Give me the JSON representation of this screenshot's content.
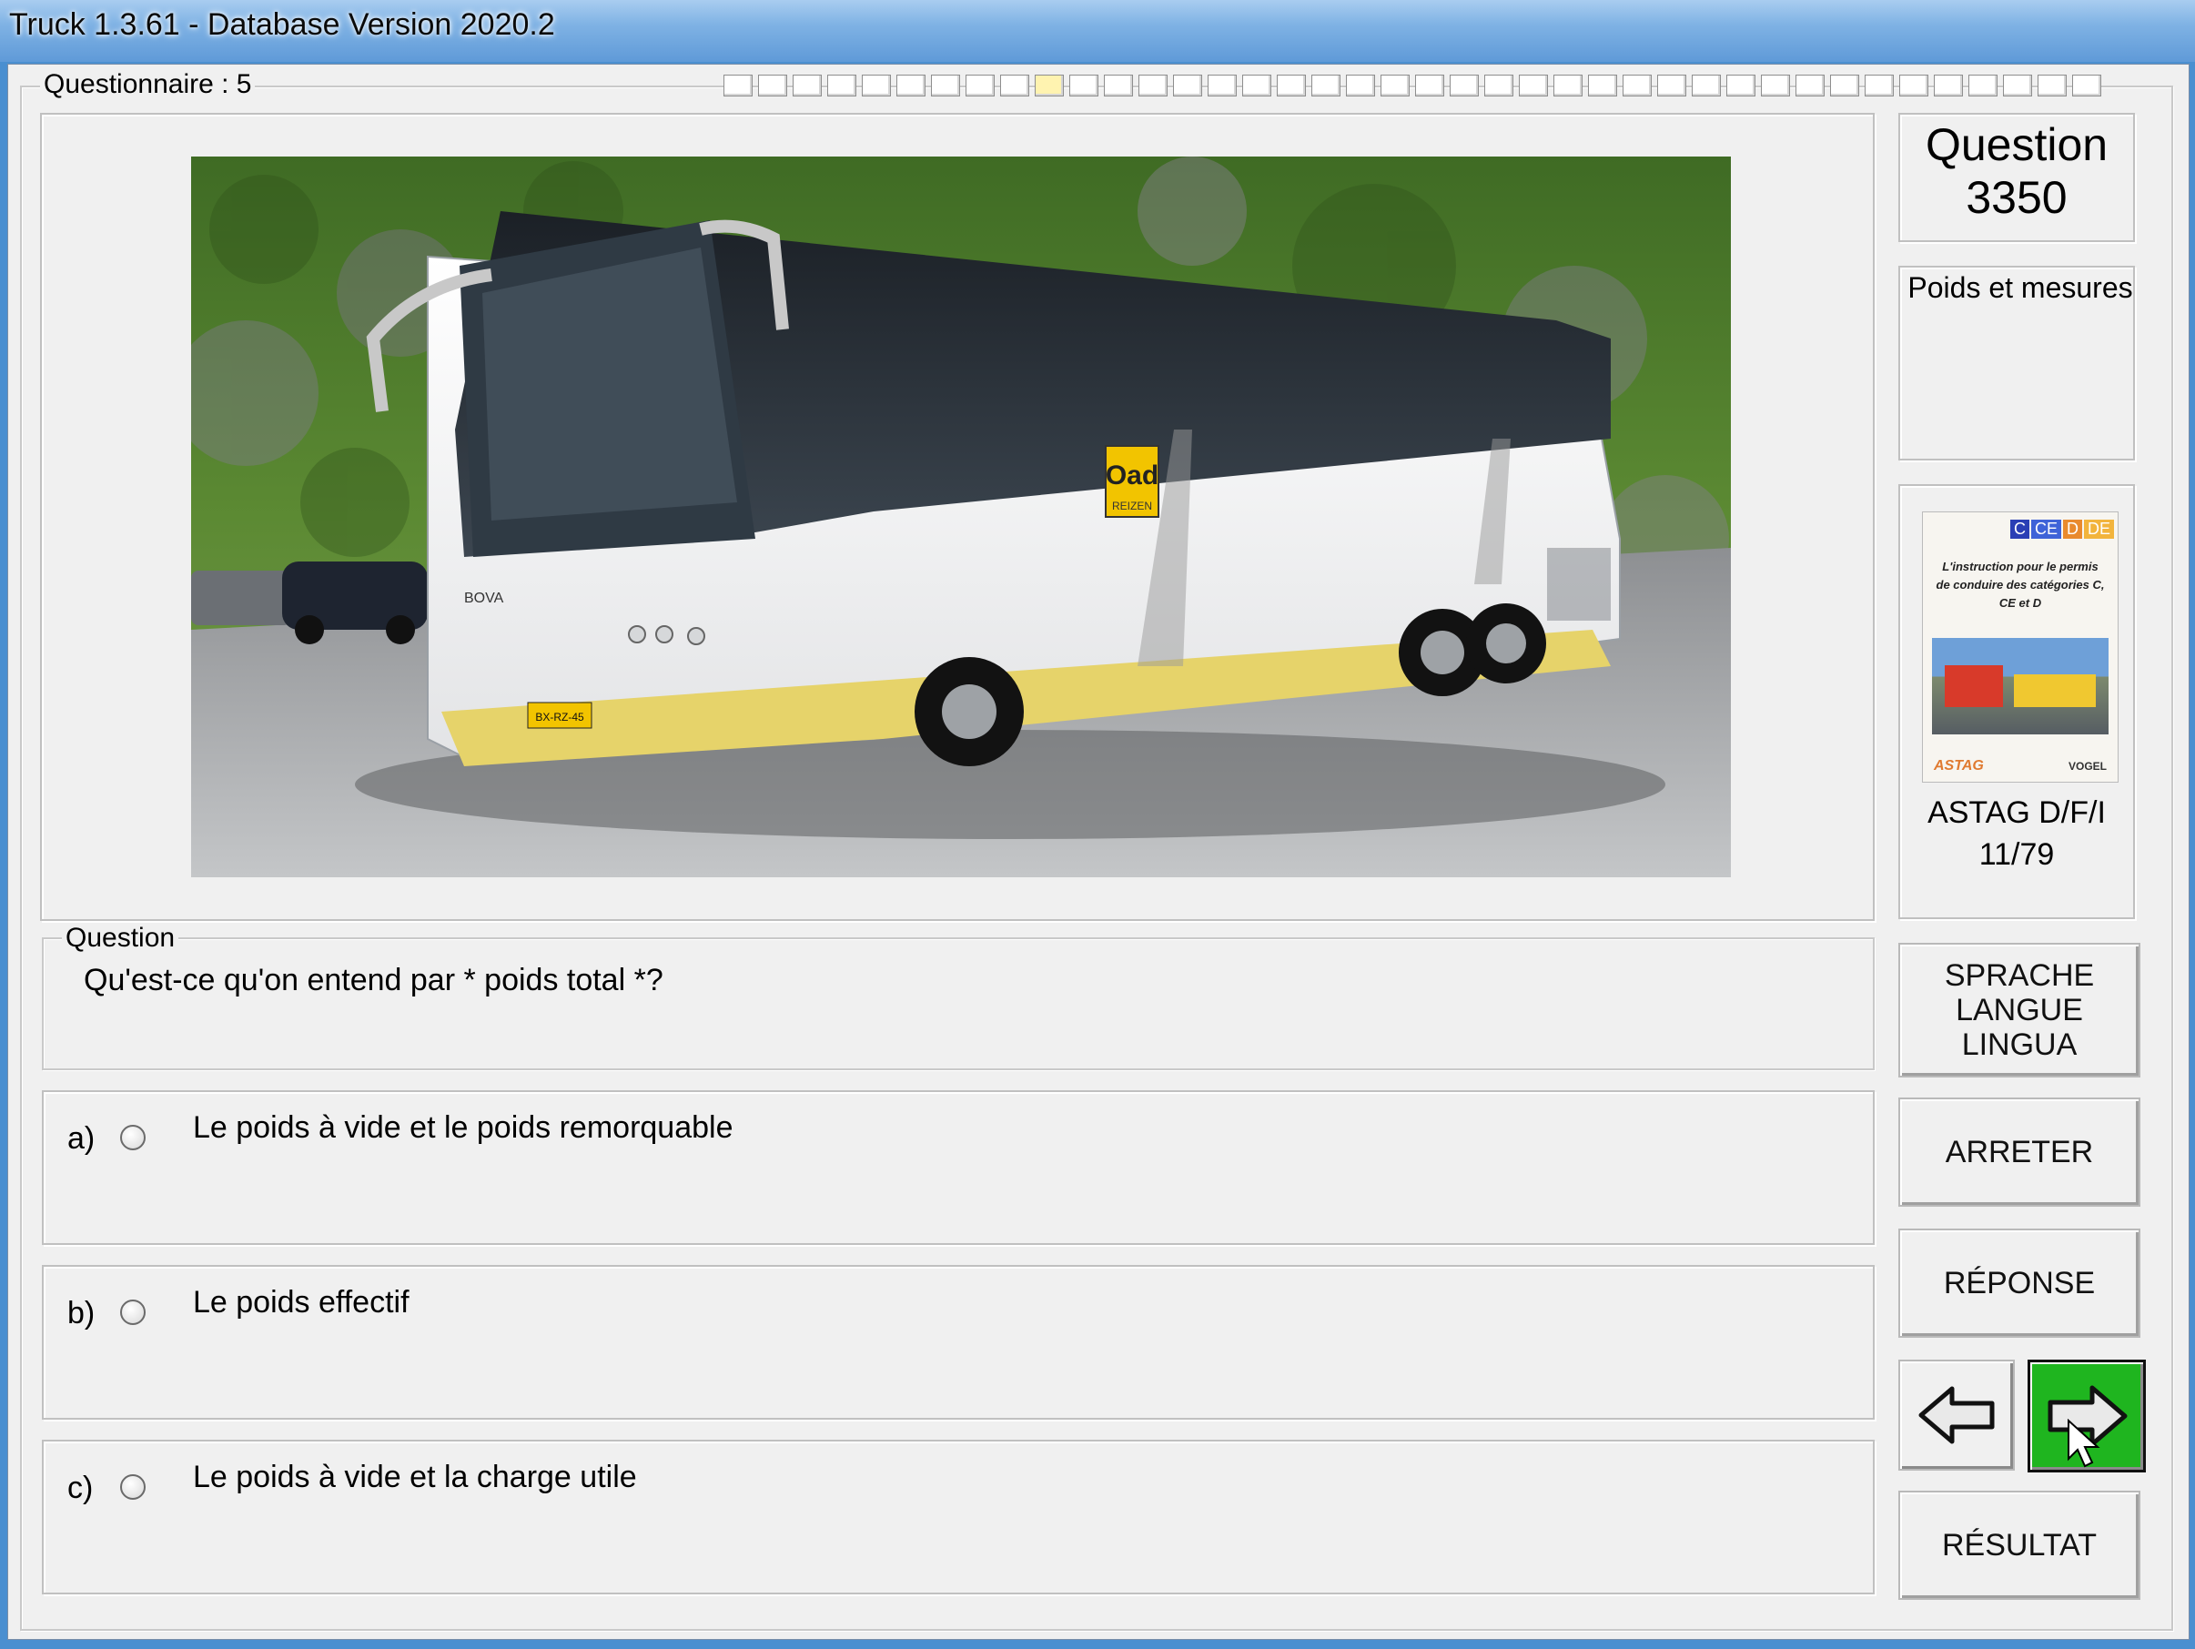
{
  "window": {
    "title": "Truck 1.3.61 - Database Version 2020.2"
  },
  "questionnaire": {
    "label": "Questionnaire : 5",
    "progress_total": 40,
    "progress_current": 10
  },
  "question": {
    "number_label": "Question",
    "number": "3350",
    "topic": "Poids et mesures",
    "section_label": "Question",
    "text": "Qu'est-ce qu'on entend par * poids total *?"
  },
  "answers": [
    {
      "letter": "a)",
      "text": "Le poids à vide et le poids remorquable"
    },
    {
      "letter": "b)",
      "text": "Le poids effectif"
    },
    {
      "letter": "c)",
      "text": "Le poids à vide et la charge utile"
    }
  ],
  "book": {
    "badges": [
      "C",
      "CE",
      "D",
      "DE"
    ],
    "cover_text": "L'instruction pour le permis de conduire des catégories C, CE et D",
    "logo_left": "ASTAG",
    "logo_right": "VOGEL",
    "source": "ASTAG D/F/I",
    "page": "11/79"
  },
  "photo": {
    "logo": "Oad",
    "logo_sub": "REIZEN",
    "brand": "BOVA",
    "plate": "BX-RZ-45"
  },
  "buttons": {
    "language": "SPRACHE\nLANGUE\nLINGUA",
    "stop": "ARRETER",
    "answer": "RÉPONSE",
    "result": "RÉSULTAT"
  },
  "colors": {
    "next_button": "#1fb51f",
    "titlebar": "#6fa6dc"
  }
}
